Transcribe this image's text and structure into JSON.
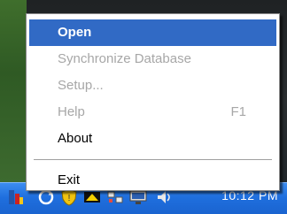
{
  "menu": {
    "items": [
      {
        "label": "Open",
        "state": "selected"
      },
      {
        "label": "Synchronize Database",
        "state": "disabled"
      },
      {
        "label": "Setup...",
        "state": "disabled"
      },
      {
        "label": "Help",
        "shortcut": "F1",
        "state": "disabled"
      },
      {
        "label": "About",
        "state": "enabled"
      }
    ],
    "exit_label": "Exit"
  },
  "taskbar": {
    "clock": "10:12 PM",
    "tray_icons": [
      "app-tray-icon",
      "refresh-tray-icon",
      "shield-tray-icon",
      "sync-tray-icon",
      "network-tray-icon",
      "display-tray-icon",
      "volume-tray-icon"
    ]
  },
  "colors": {
    "selection": "#316ac5",
    "disabled_text": "#a7a7a7",
    "taskbar": "#1f6fde"
  }
}
